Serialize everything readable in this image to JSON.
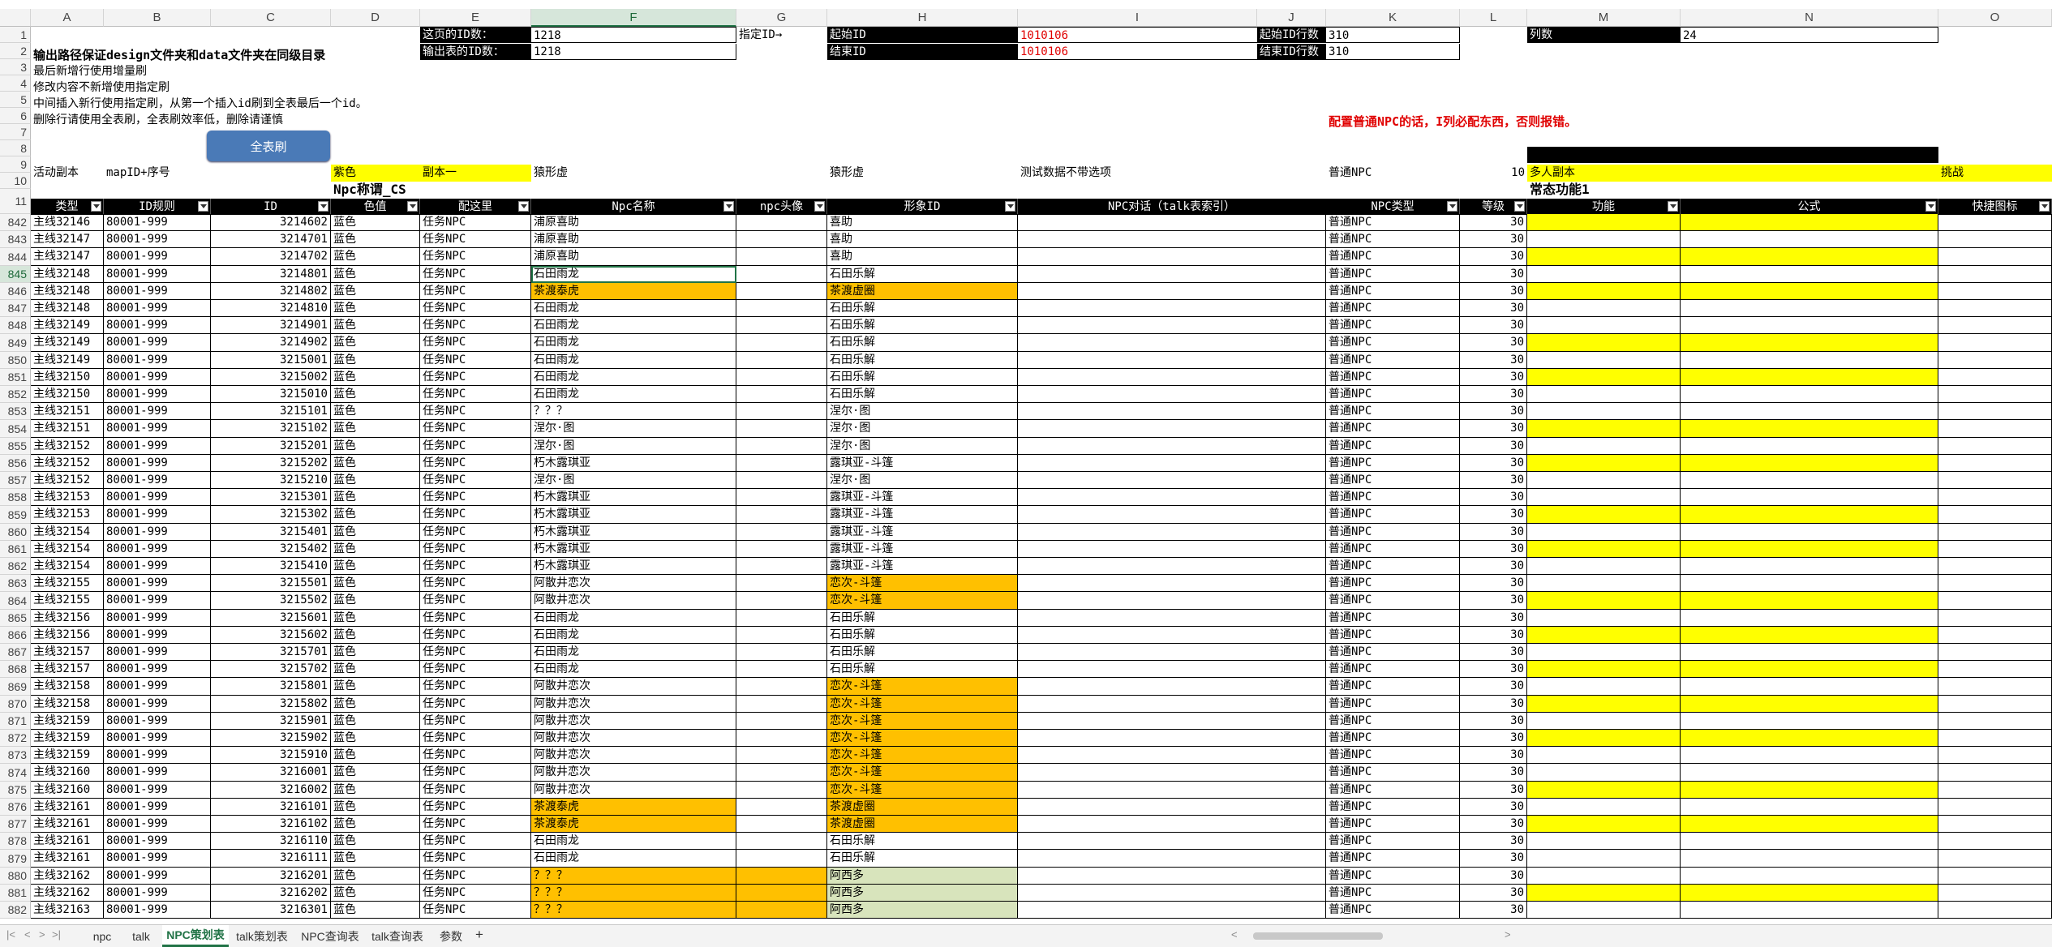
{
  "columns": [
    "A",
    "B",
    "C",
    "D",
    "E",
    "F",
    "G",
    "H",
    "I",
    "J",
    "K",
    "L",
    "M",
    "N",
    "O"
  ],
  "selected_column": "F",
  "top_rows": [
    "1",
    "2",
    "3",
    "4",
    "5",
    "6",
    "7",
    "8",
    "9",
    "10",
    "11"
  ],
  "info": {
    "page_id_label": "这页的ID数：",
    "page_id_value": "1218",
    "out_id_label": "输出表的ID数：",
    "out_id_value": "1218",
    "assign_label": "指定ID→",
    "start_id_label": "起始ID",
    "start_id_value": "1010106",
    "end_id_label": "结束ID",
    "end_id_value": "1010106",
    "start_row_label": "起始ID行数",
    "start_row_value": "310",
    "end_row_label": "结束ID行数",
    "end_row_value": "310",
    "colcount_label": "列数",
    "colcount_value": "24"
  },
  "notes": [
    "输出路径保证design文件夹和data文件夹在同级目录",
    "最后新增行使用增量刷",
    "修改内容不新增使用指定刷",
    "中间插入新行使用指定刷，从第一个插入id刷到全表最后一个id。",
    "删除行请使用全表刷，全表刷效率低，删除请谨慎"
  ],
  "warning": "配置普通NPC的话，I列必配东西，否则报错。",
  "refresh_button": "全表刷",
  "row9": {
    "A": "活动副本",
    "B": "mapID+序号",
    "D": "紫色",
    "E": "副本一",
    "F": "猿形虚",
    "H": "猿形虚",
    "I": "测试数据不带选项",
    "K": "普通NPC",
    "L": "10",
    "M": "多人副本",
    "O": "挑战"
  },
  "row10": {
    "D": "Npc称谓_CS",
    "M": "常态功能1"
  },
  "headers": {
    "A": "类型",
    "B": "ID规则",
    "C": "ID",
    "D": "色值",
    "E": "配这里",
    "F": "Npc名称",
    "G": "npc头像",
    "H": "形象ID",
    "I": "NPC对话（talk表索引）",
    "K": "NPC类型",
    "L": "等级",
    "M": "功能",
    "N": "公式",
    "O": "快捷图标"
  },
  "rows": [
    {
      "n": "842",
      "a": "主线32146",
      "b": "80001-999",
      "c": "3214602",
      "d": "蓝色",
      "e": "任务NPC",
      "f": "浦原喜助",
      "h": "喜助",
      "k": "普通NPC",
      "l": "30",
      "f_c": "",
      "h_c": "",
      "y": true
    },
    {
      "n": "843",
      "a": "主线32147",
      "b": "80001-999",
      "c": "3214701",
      "d": "蓝色",
      "e": "任务NPC",
      "f": "浦原喜助",
      "h": "喜助",
      "k": "普通NPC",
      "l": "30",
      "f_c": "",
      "h_c": "",
      "y": false
    },
    {
      "n": "844",
      "a": "主线32147",
      "b": "80001-999",
      "c": "3214702",
      "d": "蓝色",
      "e": "任务NPC",
      "f": "浦原喜助",
      "h": "喜助",
      "k": "普通NPC",
      "l": "30",
      "f_c": "",
      "h_c": "",
      "y": true
    },
    {
      "n": "845",
      "a": "主线32148",
      "b": "80001-999",
      "c": "3214801",
      "d": "蓝色",
      "e": "任务NPC",
      "f": "石田雨龙",
      "h": "石田乐解",
      "k": "普通NPC",
      "l": "30",
      "f_c": "",
      "h_c": "",
      "y": false
    },
    {
      "n": "846",
      "a": "主线32148",
      "b": "80001-999",
      "c": "3214802",
      "d": "蓝色",
      "e": "任务NPC",
      "f": "茶渡泰虎",
      "h": "茶渡虚圈",
      "k": "普通NPC",
      "l": "30",
      "f_c": "org",
      "h_c": "org",
      "y": true
    },
    {
      "n": "847",
      "a": "主线32148",
      "b": "80001-999",
      "c": "3214810",
      "d": "蓝色",
      "e": "任务NPC",
      "f": "石田雨龙",
      "h": "石田乐解",
      "k": "普通NPC",
      "l": "30",
      "f_c": "",
      "h_c": "",
      "y": false
    },
    {
      "n": "848",
      "a": "主线32149",
      "b": "80001-999",
      "c": "3214901",
      "d": "蓝色",
      "e": "任务NPC",
      "f": "石田雨龙",
      "h": "石田乐解",
      "k": "普通NPC",
      "l": "30",
      "f_c": "",
      "h_c": "",
      "y": false
    },
    {
      "n": "849",
      "a": "主线32149",
      "b": "80001-999",
      "c": "3214902",
      "d": "蓝色",
      "e": "任务NPC",
      "f": "石田雨龙",
      "h": "石田乐解",
      "k": "普通NPC",
      "l": "30",
      "f_c": "",
      "h_c": "",
      "y": true
    },
    {
      "n": "850",
      "a": "主线32149",
      "b": "80001-999",
      "c": "3215001",
      "d": "蓝色",
      "e": "任务NPC",
      "f": "石田雨龙",
      "h": "石田乐解",
      "k": "普通NPC",
      "l": "30",
      "f_c": "",
      "h_c": "",
      "y": false
    },
    {
      "n": "851",
      "a": "主线32150",
      "b": "80001-999",
      "c": "3215002",
      "d": "蓝色",
      "e": "任务NPC",
      "f": "石田雨龙",
      "h": "石田乐解",
      "k": "普通NPC",
      "l": "30",
      "f_c": "",
      "h_c": "",
      "y": true
    },
    {
      "n": "852",
      "a": "主线32150",
      "b": "80001-999",
      "c": "3215010",
      "d": "蓝色",
      "e": "任务NPC",
      "f": "石田雨龙",
      "h": "石田乐解",
      "k": "普通NPC",
      "l": "30",
      "f_c": "",
      "h_c": "",
      "y": false
    },
    {
      "n": "853",
      "a": "主线32151",
      "b": "80001-999",
      "c": "3215101",
      "d": "蓝色",
      "e": "任务NPC",
      "f": "？？？",
      "h": "涅尔·图",
      "k": "普通NPC",
      "l": "30",
      "f_c": "",
      "h_c": "",
      "y": false
    },
    {
      "n": "854",
      "a": "主线32151",
      "b": "80001-999",
      "c": "3215102",
      "d": "蓝色",
      "e": "任务NPC",
      "f": "涅尔·图",
      "h": "涅尔·图",
      "k": "普通NPC",
      "l": "30",
      "f_c": "",
      "h_c": "",
      "y": true
    },
    {
      "n": "855",
      "a": "主线32152",
      "b": "80001-999",
      "c": "3215201",
      "d": "蓝色",
      "e": "任务NPC",
      "f": "涅尔·图",
      "h": "涅尔·图",
      "k": "普通NPC",
      "l": "30",
      "f_c": "",
      "h_c": "",
      "y": false
    },
    {
      "n": "856",
      "a": "主线32152",
      "b": "80001-999",
      "c": "3215202",
      "d": "蓝色",
      "e": "任务NPC",
      "f": "朽木露琪亚",
      "h": "露琪亚-斗篷",
      "k": "普通NPC",
      "l": "30",
      "f_c": "",
      "h_c": "",
      "y": true
    },
    {
      "n": "857",
      "a": "主线32152",
      "b": "80001-999",
      "c": "3215210",
      "d": "蓝色",
      "e": "任务NPC",
      "f": "涅尔·图",
      "h": "涅尔·图",
      "k": "普通NPC",
      "l": "30",
      "f_c": "",
      "h_c": "",
      "y": false
    },
    {
      "n": "858",
      "a": "主线32153",
      "b": "80001-999",
      "c": "3215301",
      "d": "蓝色",
      "e": "任务NPC",
      "f": "朽木露琪亚",
      "h": "露琪亚-斗篷",
      "k": "普通NPC",
      "l": "30",
      "f_c": "",
      "h_c": "",
      "y": false
    },
    {
      "n": "859",
      "a": "主线32153",
      "b": "80001-999",
      "c": "3215302",
      "d": "蓝色",
      "e": "任务NPC",
      "f": "朽木露琪亚",
      "h": "露琪亚-斗篷",
      "k": "普通NPC",
      "l": "30",
      "f_c": "",
      "h_c": "",
      "y": true
    },
    {
      "n": "860",
      "a": "主线32154",
      "b": "80001-999",
      "c": "3215401",
      "d": "蓝色",
      "e": "任务NPC",
      "f": "朽木露琪亚",
      "h": "露琪亚-斗篷",
      "k": "普通NPC",
      "l": "30",
      "f_c": "",
      "h_c": "",
      "y": false
    },
    {
      "n": "861",
      "a": "主线32154",
      "b": "80001-999",
      "c": "3215402",
      "d": "蓝色",
      "e": "任务NPC",
      "f": "朽木露琪亚",
      "h": "露琪亚-斗篷",
      "k": "普通NPC",
      "l": "30",
      "f_c": "",
      "h_c": "",
      "y": true
    },
    {
      "n": "862",
      "a": "主线32154",
      "b": "80001-999",
      "c": "3215410",
      "d": "蓝色",
      "e": "任务NPC",
      "f": "朽木露琪亚",
      "h": "露琪亚-斗篷",
      "k": "普通NPC",
      "l": "30",
      "f_c": "",
      "h_c": "",
      "y": false
    },
    {
      "n": "863",
      "a": "主线32155",
      "b": "80001-999",
      "c": "3215501",
      "d": "蓝色",
      "e": "任务NPC",
      "f": "阿散井恋次",
      "h": "恋次-斗篷",
      "k": "普通NPC",
      "l": "30",
      "f_c": "",
      "h_c": "org",
      "y": false
    },
    {
      "n": "864",
      "a": "主线32155",
      "b": "80001-999",
      "c": "3215502",
      "d": "蓝色",
      "e": "任务NPC",
      "f": "阿散井恋次",
      "h": "恋次-斗篷",
      "k": "普通NPC",
      "l": "30",
      "f_c": "",
      "h_c": "org",
      "y": true
    },
    {
      "n": "865",
      "a": "主线32156",
      "b": "80001-999",
      "c": "3215601",
      "d": "蓝色",
      "e": "任务NPC",
      "f": "石田雨龙",
      "h": "石田乐解",
      "k": "普通NPC",
      "l": "30",
      "f_c": "",
      "h_c": "",
      "y": false
    },
    {
      "n": "866",
      "a": "主线32156",
      "b": "80001-999",
      "c": "3215602",
      "d": "蓝色",
      "e": "任务NPC",
      "f": "石田雨龙",
      "h": "石田乐解",
      "k": "普通NPC",
      "l": "30",
      "f_c": "",
      "h_c": "",
      "y": true
    },
    {
      "n": "867",
      "a": "主线32157",
      "b": "80001-999",
      "c": "3215701",
      "d": "蓝色",
      "e": "任务NPC",
      "f": "石田雨龙",
      "h": "石田乐解",
      "k": "普通NPC",
      "l": "30",
      "f_c": "",
      "h_c": "",
      "y": false
    },
    {
      "n": "868",
      "a": "主线32157",
      "b": "80001-999",
      "c": "3215702",
      "d": "蓝色",
      "e": "任务NPC",
      "f": "石田雨龙",
      "h": "石田乐解",
      "k": "普通NPC",
      "l": "30",
      "f_c": "",
      "h_c": "",
      "y": true
    },
    {
      "n": "869",
      "a": "主线32158",
      "b": "80001-999",
      "c": "3215801",
      "d": "蓝色",
      "e": "任务NPC",
      "f": "阿散井恋次",
      "h": "恋次-斗篷",
      "k": "普通NPC",
      "l": "30",
      "f_c": "",
      "h_c": "org",
      "y": false
    },
    {
      "n": "870",
      "a": "主线32158",
      "b": "80001-999",
      "c": "3215802",
      "d": "蓝色",
      "e": "任务NPC",
      "f": "阿散井恋次",
      "h": "恋次-斗篷",
      "k": "普通NPC",
      "l": "30",
      "f_c": "",
      "h_c": "org",
      "y": true
    },
    {
      "n": "871",
      "a": "主线32159",
      "b": "80001-999",
      "c": "3215901",
      "d": "蓝色",
      "e": "任务NPC",
      "f": "阿散井恋次",
      "h": "恋次-斗篷",
      "k": "普通NPC",
      "l": "30",
      "f_c": "",
      "h_c": "org",
      "y": false
    },
    {
      "n": "872",
      "a": "主线32159",
      "b": "80001-999",
      "c": "3215902",
      "d": "蓝色",
      "e": "任务NPC",
      "f": "阿散井恋次",
      "h": "恋次-斗篷",
      "k": "普通NPC",
      "l": "30",
      "f_c": "",
      "h_c": "org",
      "y": true
    },
    {
      "n": "873",
      "a": "主线32159",
      "b": "80001-999",
      "c": "3215910",
      "d": "蓝色",
      "e": "任务NPC",
      "f": "阿散井恋次",
      "h": "恋次-斗篷",
      "k": "普通NPC",
      "l": "30",
      "f_c": "",
      "h_c": "org",
      "y": false
    },
    {
      "n": "874",
      "a": "主线32160",
      "b": "80001-999",
      "c": "3216001",
      "d": "蓝色",
      "e": "任务NPC",
      "f": "阿散井恋次",
      "h": "恋次-斗篷",
      "k": "普通NPC",
      "l": "30",
      "f_c": "",
      "h_c": "org",
      "y": false
    },
    {
      "n": "875",
      "a": "主线32160",
      "b": "80001-999",
      "c": "3216002",
      "d": "蓝色",
      "e": "任务NPC",
      "f": "阿散井恋次",
      "h": "恋次-斗篷",
      "k": "普通NPC",
      "l": "30",
      "f_c": "",
      "h_c": "org",
      "y": true
    },
    {
      "n": "876",
      "a": "主线32161",
      "b": "80001-999",
      "c": "3216101",
      "d": "蓝色",
      "e": "任务NPC",
      "f": "茶渡泰虎",
      "h": "茶渡虚圈",
      "k": "普通NPC",
      "l": "30",
      "f_c": "org",
      "h_c": "org",
      "y": false
    },
    {
      "n": "877",
      "a": "主线32161",
      "b": "80001-999",
      "c": "3216102",
      "d": "蓝色",
      "e": "任务NPC",
      "f": "茶渡泰虎",
      "h": "茶渡虚圈",
      "k": "普通NPC",
      "l": "30",
      "f_c": "org",
      "h_c": "org",
      "y": true
    },
    {
      "n": "878",
      "a": "主线32161",
      "b": "80001-999",
      "c": "3216110",
      "d": "蓝色",
      "e": "任务NPC",
      "f": "石田雨龙",
      "h": "石田乐解",
      "k": "普通NPC",
      "l": "30",
      "f_c": "",
      "h_c": "",
      "y": false
    },
    {
      "n": "879",
      "a": "主线32161",
      "b": "80001-999",
      "c": "3216111",
      "d": "蓝色",
      "e": "任务NPC",
      "f": "石田雨龙",
      "h": "石田乐解",
      "k": "普通NPC",
      "l": "30",
      "f_c": "",
      "h_c": "",
      "y": false
    },
    {
      "n": "880",
      "a": "主线32162",
      "b": "80001-999",
      "c": "3216201",
      "d": "蓝色",
      "e": "任务NPC",
      "f": "？？？",
      "h": "阿西多",
      "k": "普通NPC",
      "l": "30",
      "f_c": "org",
      "h_c": "grn",
      "y": false
    },
    {
      "n": "881",
      "a": "主线32162",
      "b": "80001-999",
      "c": "3216202",
      "d": "蓝色",
      "e": "任务NPC",
      "f": "？？？",
      "h": "阿西多",
      "k": "普通NPC",
      "l": "30",
      "f_c": "org",
      "h_c": "grn",
      "y": true
    },
    {
      "n": "882",
      "a": "主线32163",
      "b": "80001-999",
      "c": "3216301",
      "d": "蓝色",
      "e": "任务NPC",
      "f": "？？？",
      "h": "阿西多",
      "k": "普通NPC",
      "l": "30",
      "f_c": "org",
      "h_c": "grn",
      "y": false
    }
  ],
  "sheet_tabs": [
    "npc",
    "talk",
    "NPC策划表",
    "talk策划表",
    "NPC查询表",
    "talk查询表",
    "参数"
  ],
  "active_tab": "NPC策划表",
  "colors": {
    "excel_green": "#217346",
    "yellow": "#ffff00",
    "orange": "#ffc000",
    "green_fill": "#d8e4bc",
    "warning_red": "#e00000"
  }
}
